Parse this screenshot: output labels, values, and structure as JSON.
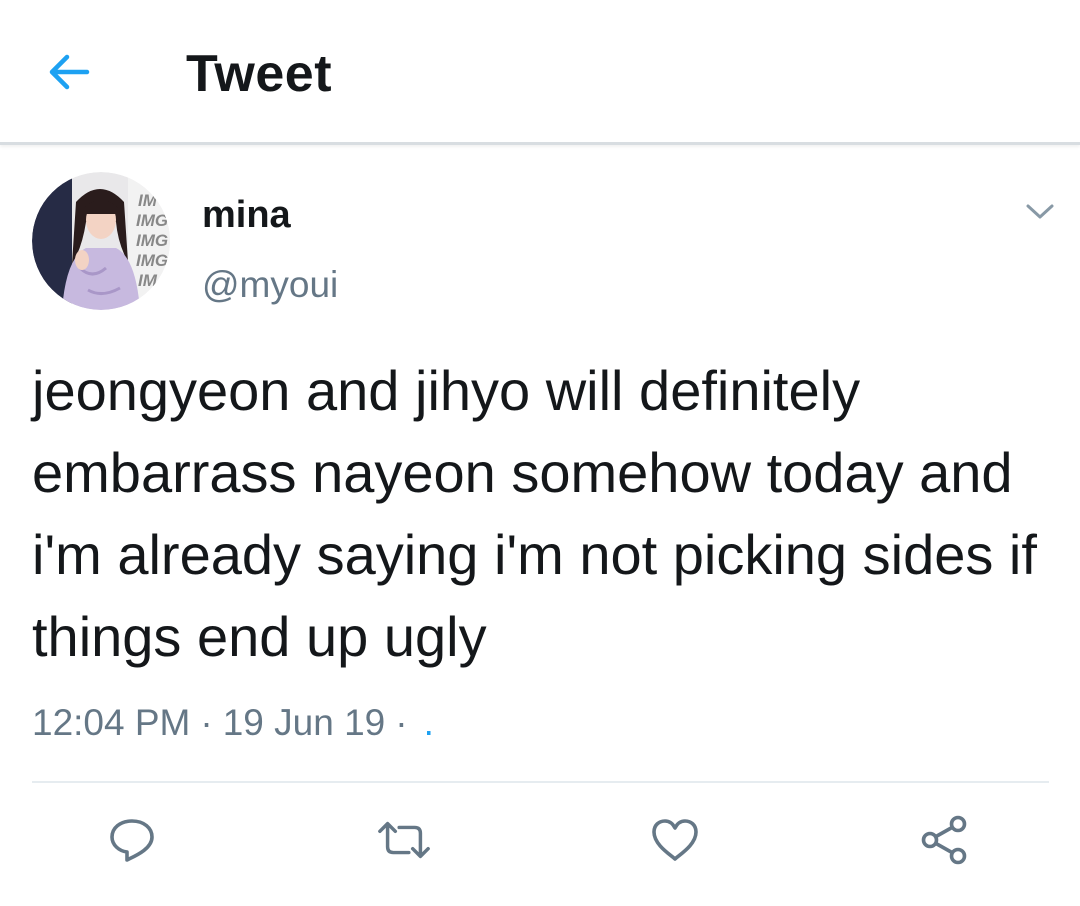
{
  "header": {
    "title": "Tweet",
    "back_icon": "arrow-left-icon",
    "accent_color": "#1da1f2"
  },
  "tweet": {
    "display_name": "mina",
    "handle": "@myoui",
    "text": "jeongyeon and jihyo will definitely embarrass nayeon somehow today and i'm already saying i'm not picking sides if things end up ugly",
    "time": "12:04 PM",
    "date": "19 Jun 19",
    "source": ".",
    "separator": "·",
    "avatar_backdrop_text": [
      "IM",
      "IMG",
      "IMG",
      "IMG",
      "IM"
    ]
  },
  "actions": [
    {
      "name": "reply",
      "icon": "reply-icon"
    },
    {
      "name": "retweet",
      "icon": "retweet-icon"
    },
    {
      "name": "like",
      "icon": "heart-icon"
    },
    {
      "name": "share",
      "icon": "share-icon"
    }
  ],
  "colors": {
    "text_primary": "#14171a",
    "text_secondary": "#657786",
    "icon_gray": "#657786",
    "divider": "#e6ecf0"
  }
}
